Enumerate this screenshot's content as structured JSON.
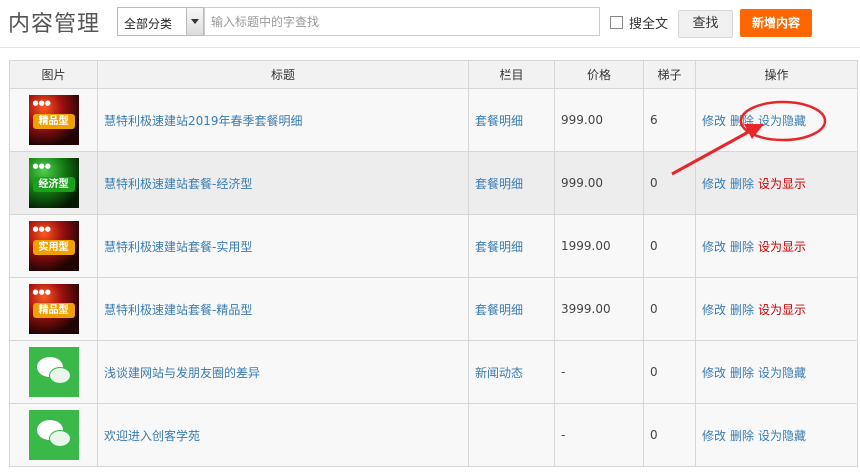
{
  "header": {
    "title": "内容管理",
    "category_selected": "全部分类",
    "search_placeholder": "输入标题中的字查找",
    "fulltext_label": "搜全文",
    "search_button": "查找",
    "add_button": "新增内容"
  },
  "table": {
    "columns": [
      "图片",
      "标题",
      "栏目",
      "价格",
      "梯子",
      "操作"
    ],
    "rows": [
      {
        "thumb": "product-package",
        "badge": "精品型",
        "badge_color": "#f0a000",
        "title": "慧特利极速建站2019年春季套餐明细",
        "column": "套餐明细",
        "price": "999.00",
        "ladder": "6",
        "op_edit": "修改",
        "op_delete": "删除",
        "op_toggle": "设为隐藏",
        "toggle_color": "#3a7cb2"
      },
      {
        "thumb": "product-package",
        "badge": "经济型",
        "badge_color": "#1aa01a",
        "title": "慧特利极速建站套餐-经济型",
        "column": "套餐明细",
        "price": "999.00",
        "ladder": "0",
        "op_edit": "修改",
        "op_delete": "删除",
        "op_toggle": "设为显示",
        "toggle_color": "#cc0000"
      },
      {
        "thumb": "product-package",
        "badge": "实用型",
        "badge_color": "#f0a000",
        "title": "慧特利极速建站套餐-实用型",
        "column": "套餐明细",
        "price": "1999.00",
        "ladder": "0",
        "op_edit": "修改",
        "op_delete": "删除",
        "op_toggle": "设为显示",
        "toggle_color": "#cc0000"
      },
      {
        "thumb": "product-package",
        "badge": "精品型",
        "badge_color": "#f0a000",
        "title": "慧特利极速建站套餐-精品型",
        "column": "套餐明细",
        "price": "3999.00",
        "ladder": "0",
        "op_edit": "修改",
        "op_delete": "删除",
        "op_toggle": "设为显示",
        "toggle_color": "#cc0000"
      },
      {
        "thumb": "wechat-logo",
        "title": "浅谈建网站与发朋友圈的差异",
        "column": "新闻动态",
        "price": "-",
        "ladder": "0",
        "op_edit": "修改",
        "op_delete": "删除",
        "op_toggle": "设为隐藏",
        "toggle_color": "#3a7cb2"
      },
      {
        "thumb": "wechat-logo",
        "title": "欢迎进入创客学苑",
        "column": "",
        "price": "-",
        "ladder": "0",
        "op_edit": "修改",
        "op_delete": "删除",
        "op_toggle": "设为隐藏",
        "toggle_color": "#3a7cb2"
      }
    ]
  },
  "annotation": {
    "icon": "red-arrow-icon",
    "color": "#e8262a"
  },
  "colors": {
    "accent": "#ff6600",
    "link": "#3a7cb2",
    "danger": "#cc0000"
  }
}
